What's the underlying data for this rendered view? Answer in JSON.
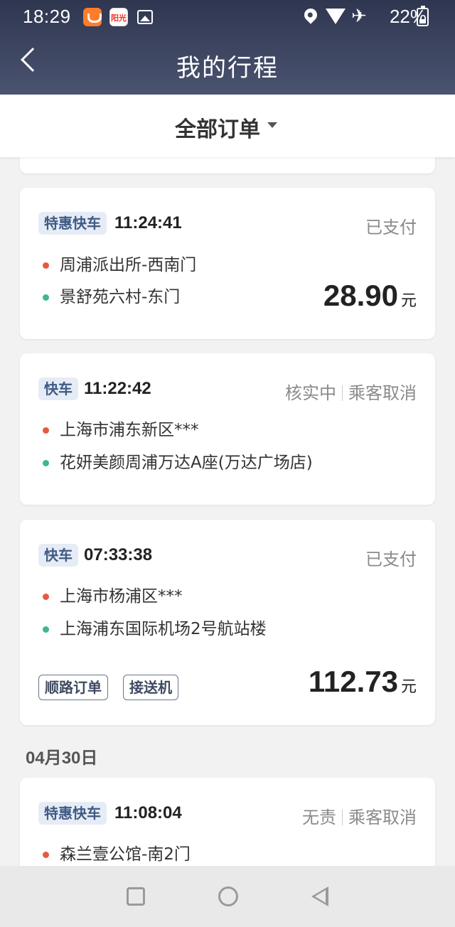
{
  "status_bar": {
    "time": "18:29",
    "battery": "22%",
    "icons": [
      "didi-app-icon",
      "sunshine-app-icon",
      "image-icon",
      "location-icon",
      "wifi-icon",
      "airplane-icon",
      "battery-icon"
    ]
  },
  "header": {
    "title": "我的行程",
    "back_icon": "back-arrow-icon"
  },
  "filter": {
    "label": "全部订单"
  },
  "orders": [
    {
      "tag": "特惠快车",
      "time": "11:24:41",
      "status": "已支付",
      "status_extra": "",
      "start": "周浦派出所-西南门",
      "end": "景舒苑六村-东门",
      "price": "28.90",
      "unit": "元",
      "chips": []
    },
    {
      "tag": "快车",
      "time": "11:22:42",
      "status": "核实中",
      "status_extra": "乘客取消",
      "start": "上海市浦东新区***",
      "end": "花妍美颜周浦万达A座(万达广场店)",
      "price": "",
      "unit": "",
      "chips": []
    },
    {
      "tag": "快车",
      "time": "07:33:38",
      "status": "已支付",
      "status_extra": "",
      "start": "上海市杨浦区***",
      "end": "上海浦东国际机场2号航站楼",
      "price": "112.73",
      "unit": "元",
      "chips": [
        "顺路订单",
        "接送机"
      ]
    },
    {
      "tag": "特惠快车",
      "time": "11:08:04",
      "status": "无责",
      "status_extra": "乘客取消",
      "start": "森兰壹公馆-南2门",
      "end": "",
      "price": "",
      "unit": "",
      "chips": []
    }
  ],
  "date_header": "04月30日",
  "colors": {
    "header_bg": "#3a4260",
    "tag_bg": "#e6ecf5",
    "tag_text": "#3f5a86",
    "start_dot": "#e65a3c",
    "end_dot": "#3fb88a"
  }
}
